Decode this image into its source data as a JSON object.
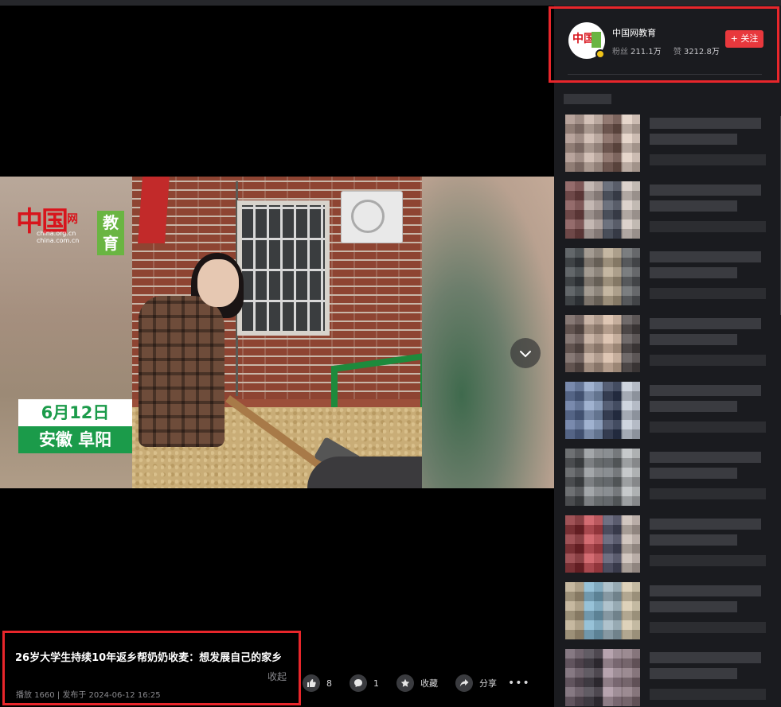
{
  "player": {
    "logo": {
      "wordmark": "中国",
      "wordmark_net": "网",
      "url_line1": "china.org.cn",
      "url_line2": "china.com.cn",
      "badge_line1": "教",
      "badge_line2": "育"
    },
    "date_overlay": {
      "line1": "6月12日",
      "line2": "安徽 阜阳"
    },
    "next_icon": "chevron-down-icon"
  },
  "video": {
    "title": "26岁大学生持续10年返乡帮奶奶收麦：想发展自己的家乡",
    "collapse_label": "收起",
    "meta": "播放 1660 | 发布于 2024-06-12 16:25"
  },
  "actions": {
    "like": {
      "icon": "thumbs-up-icon",
      "count": "8"
    },
    "comment": {
      "icon": "comment-icon",
      "count": "1"
    },
    "favorite": {
      "icon": "star-icon",
      "label": "收藏"
    },
    "share": {
      "icon": "share-icon",
      "label": "分享"
    },
    "more_label": "•••"
  },
  "author": {
    "name": "中国网教育",
    "avatar_text": "中国",
    "fans_label": "粉丝",
    "fans_value": "211.1万",
    "likes_label": "赞",
    "likes_value": "3212.8万",
    "follow_label": "+ 关注"
  },
  "colors": {
    "accent_red": "#e8383d",
    "highlight_box": "#e8262b",
    "overlay_green": "#1b9b4a",
    "sidebar_bg": "#1a1b1f"
  }
}
